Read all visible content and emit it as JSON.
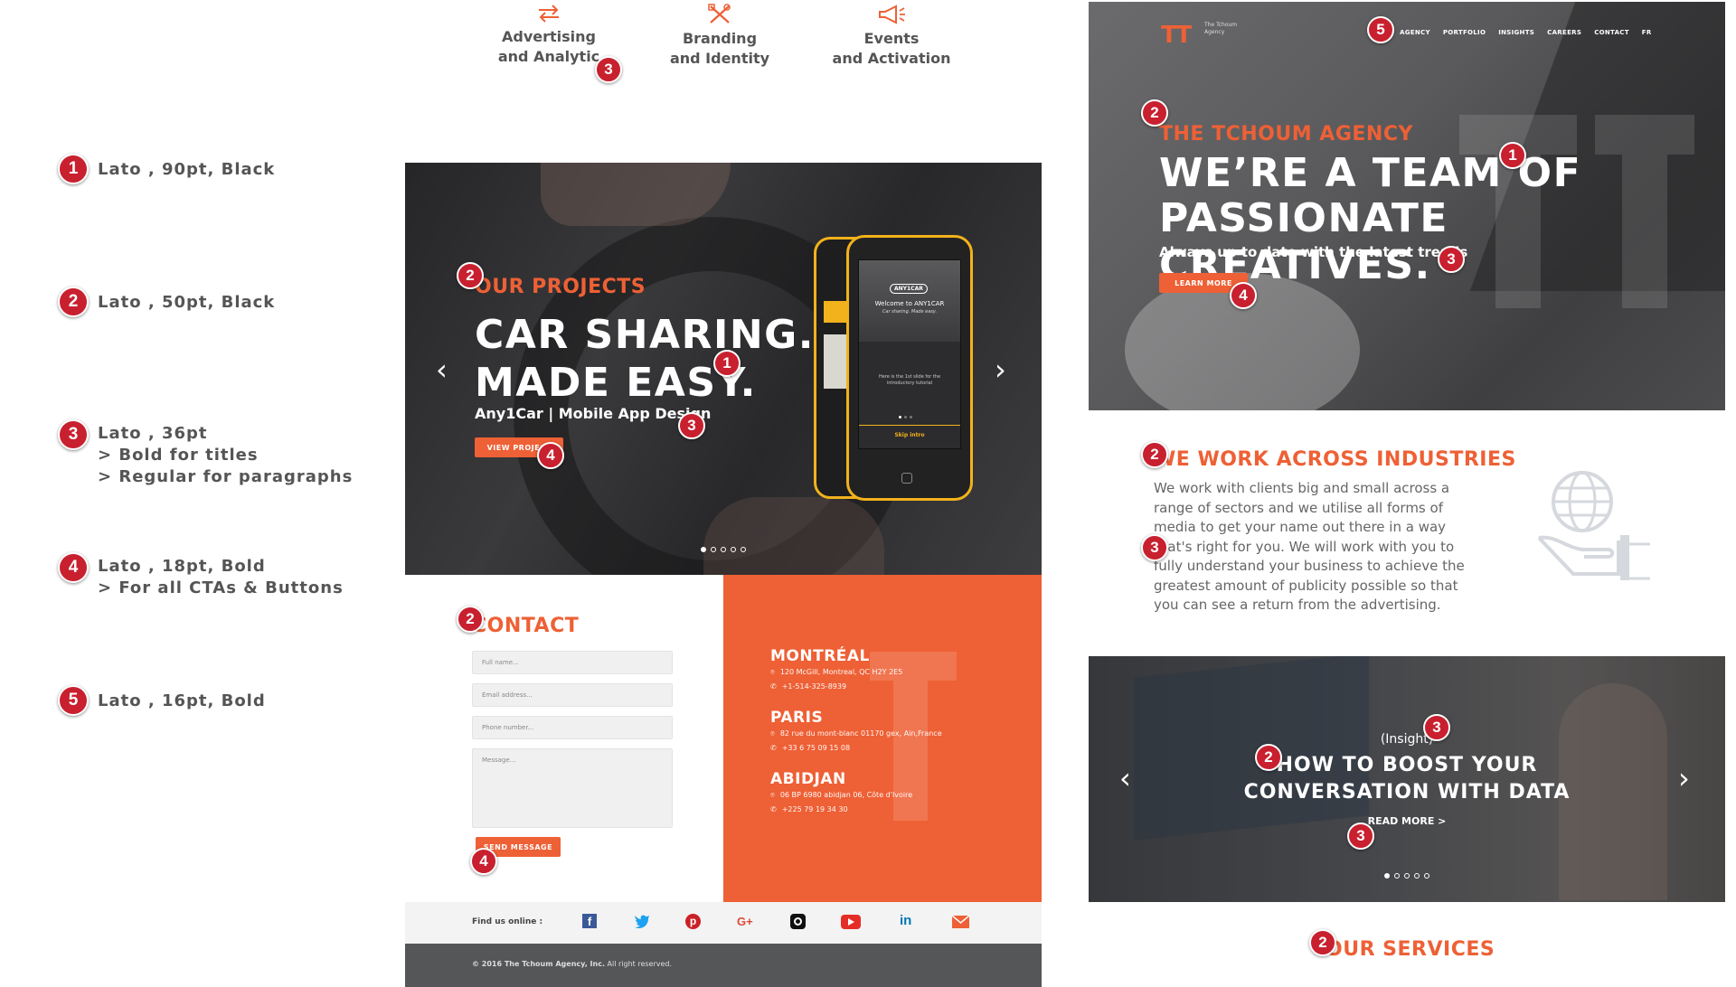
{
  "colors": {
    "accent": "#ee6035",
    "badge": "#c8202f",
    "dark": "#3b3b3d"
  },
  "legend": [
    {
      "num": "1",
      "text": "Lato , 90pt, Black"
    },
    {
      "num": "2",
      "text": "Lato , 50pt, Black"
    },
    {
      "num": "3",
      "line1": "Lato , 36pt",
      "line2": "> Bold for titles",
      "line3": "> Regular for paragraphs"
    },
    {
      "num": "4",
      "line1": "Lato , 18pt, Bold",
      "line2": "> For all CTAs & Buttons"
    },
    {
      "num": "5",
      "text": "Lato , 16pt, Bold"
    }
  ],
  "services": [
    {
      "line1": "Advertising",
      "line2": "and Analytic",
      "icon": "arrows-exchange-icon"
    },
    {
      "line1": "Branding",
      "line2": "and Identity",
      "icon": "tools-cross-icon"
    },
    {
      "line1": "Events",
      "line2": "and Activation",
      "icon": "megaphone-icon"
    }
  ],
  "projects": {
    "eyebrow": "OUR PROJECTS",
    "title1": "CAR SHARING.",
    "title2": "MADE EASY.",
    "subtitle": "Any1Car  |  Mobile App Design",
    "cta": "VIEW PROJECT",
    "phone_logo": "ANY1CAR",
    "phone_welcome": "Welcome to ANY1CAR",
    "phone_tagline": "Car sharing. Made easy.",
    "phone_slide": "Here is the 1st slide for the introductory tutorial",
    "phone_skip": "Skip intro"
  },
  "contact": {
    "title": "CONTACT",
    "fullname_placeholder": "Full name...",
    "email_placeholder": "Email address...",
    "phone_placeholder": "Phone number...",
    "message_placeholder": "Message...",
    "send": "SEND MESSAGE",
    "offices": [
      {
        "city": "MONTRÉAL",
        "address": "120 McGill, Montreal, QC H2Y 2E5",
        "phone": "+1-514-325-8939"
      },
      {
        "city": "PARIS",
        "address": "82 rue du mont-blanc 01170 gex, Ain,France",
        "phone": "+33 6 75 09 15 08"
      },
      {
        "city": "ABIDJAN",
        "address": "06 BP 6980 abidjan 06, Côte d'Ivoire",
        "phone": "+225 79 19 34 30"
      }
    ]
  },
  "footer": {
    "find_us": "Find us online :",
    "copyright_bold": "© 2016 The Tchoum Agency, Inc.",
    "copyright_rest": " All right reserved."
  },
  "hero": {
    "logo": "TT",
    "logo_name": "The Tchoum Agency",
    "nav": [
      "AGENCY",
      "PORTFOLIO",
      "INSIGHTS",
      "CAREERS",
      "CONTACT",
      "FR"
    ],
    "eyebrow": "THE TCHOUM AGENCY",
    "title1": "WE’RE A TEAM OF",
    "title2": "PASSIONATE CREATIVES.",
    "subtitle": "Always up to date with the latest trends",
    "cta": "LEARN MORE"
  },
  "industries": {
    "title": "WE WORK ACROSS INDUSTRIES",
    "body": "We work with clients big and small across a range of sectors and we utilise all forms of media to get your name out there in a way that's right for you. We will work with you to fully understand your business to achieve the greatest amount of publicity possible so that you can see a return from the advertising."
  },
  "insight": {
    "tag": "(Insight)",
    "title1": "HOW TO BOOST YOUR",
    "title2": "CONVERSATION WITH DATA",
    "cta": "READ MORE  >"
  },
  "services_heading": "OUR SERVICES"
}
